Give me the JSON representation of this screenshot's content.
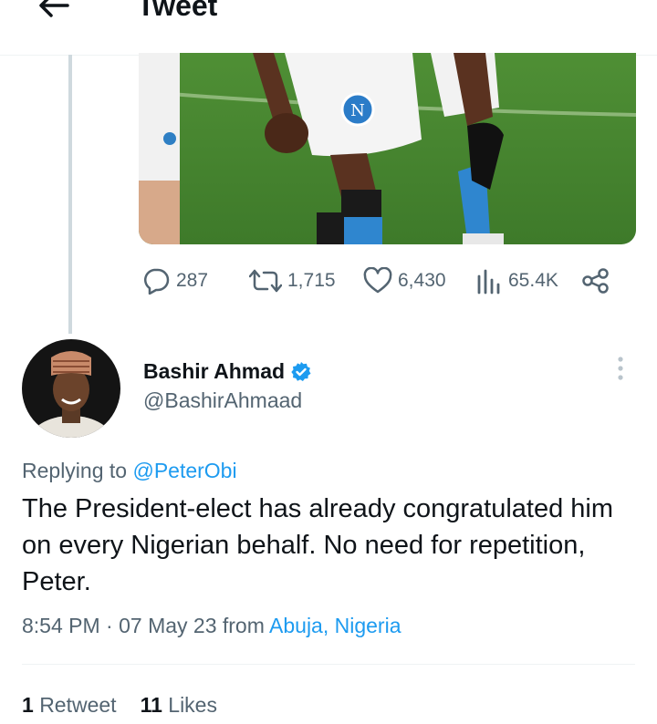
{
  "header": {
    "title": "Tweet",
    "back_icon": "arrow-left-icon"
  },
  "quoted_tweet": {
    "media_icon": "photo-football-players",
    "actions": {
      "replies": "287",
      "retweets": "1,715",
      "likes": "6,430",
      "views": "65.4K"
    }
  },
  "tweet": {
    "author_name": "Bashir Ahmad",
    "author_handle": "@BashirAhmaad",
    "verified_icon": "verified-badge-icon",
    "replying_prefix": "Replying to",
    "replying_to": "@PeterObi",
    "text": "The President-elect has already congratulated him on every Nigerian behalf. No need for repetition, Peter.",
    "time_date": "8:54 PM · 07 May 23 from",
    "location": "Abuja, Nigeria",
    "retweets_count": "1",
    "retweets_label": "Retweet",
    "likes_count": "11",
    "likes_label": "Likes"
  },
  "colors": {
    "accent": "#1d9bf0",
    "secondary_text": "#536471",
    "primary_text": "#0f1419"
  }
}
